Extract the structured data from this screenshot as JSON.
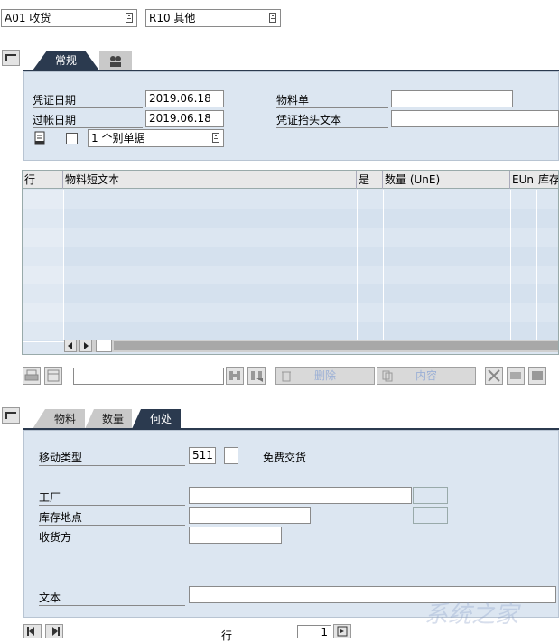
{
  "header": {
    "transaction": "A01 收货",
    "reference": "R10 其他"
  },
  "top_tabs": [
    {
      "label": "常规",
      "active": true
    },
    {
      "label": "",
      "icon": "people-icon",
      "active": false
    }
  ],
  "general": {
    "doc_date_label": "凭证日期",
    "doc_date": "2019.06.18",
    "posting_date_label": "过帐日期",
    "posting_date": "2019.06.18",
    "material_slip_label": "物料单",
    "material_slip": "",
    "header_text_label": "凭证抬头文本",
    "header_text": "",
    "slip_option": "1 个别单据"
  },
  "grid": {
    "columns": [
      "行",
      "物料短文本",
      "是",
      "数量 (UnE)",
      "EUn",
      "库存"
    ],
    "row_count": 8
  },
  "toolbar": {
    "delete_label": "删除",
    "contents_label": "内容",
    "search_value": ""
  },
  "bottom_tabs": [
    {
      "label": "物料",
      "active": false
    },
    {
      "label": "数量",
      "active": false
    },
    {
      "label": "何处",
      "active": true
    }
  ],
  "where": {
    "movement_type_label": "移动类型",
    "movement_type": "511",
    "movement_desc": "免费交货",
    "plant_label": "工厂",
    "storage_label": "库存地点",
    "recipient_label": "收货方",
    "text_label": "文本"
  },
  "footer": {
    "row_label": "行",
    "row_value": "1"
  },
  "watermark": "系统之家"
}
